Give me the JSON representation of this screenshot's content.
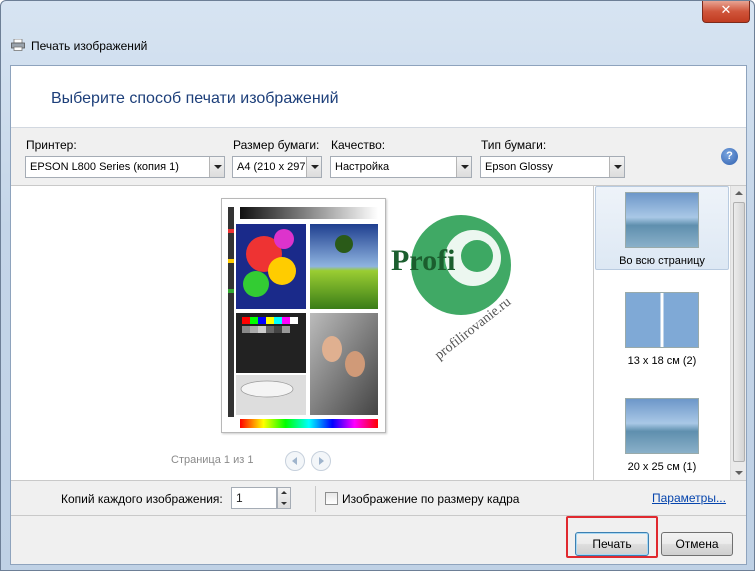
{
  "window": {
    "title": "Печать изображений",
    "close_glyph": "✕"
  },
  "header": {
    "title": "Выберите способ печати изображений"
  },
  "toolbar": {
    "printer_label": "Принтер:",
    "printer_value": "EPSON L800 Series (копия 1)",
    "paper_size_label": "Размер бумаги:",
    "paper_size_value": "A4 (210 x 297",
    "quality_label": "Качество:",
    "quality_value": "Настройка",
    "paper_type_label": "Тип бумаги:",
    "paper_type_value": "Epson Glossy",
    "help_glyph": "?"
  },
  "preview": {
    "page_label": "Страница 1 из 1"
  },
  "watermark": {
    "brand": "Profi",
    "site": "profilirovanie.ru"
  },
  "layouts": [
    {
      "label": "Во всю страницу",
      "selected": true
    },
    {
      "label": "13 x 18 см (2)",
      "selected": false
    },
    {
      "label": "20 x 25 см (1)",
      "selected": false
    }
  ],
  "options": {
    "copies_label": "Копий каждого изображения:",
    "copies_value": "1",
    "fit_label": "Изображение по размеру кадра",
    "params_link": "Параметры..."
  },
  "footer": {
    "print_label": "Печать",
    "cancel_label": "Отмена"
  },
  "colors": {
    "header_text": "#1d3f7a",
    "highlight": "#e0292f",
    "link": "#0645ad"
  }
}
